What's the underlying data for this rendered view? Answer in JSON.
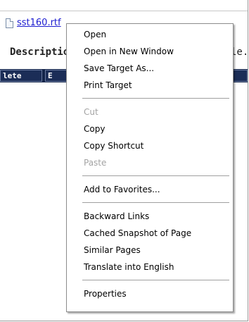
{
  "page": {
    "file_link": "sst160.rtf",
    "description_label": "Description",
    "description_tail": "le.",
    "buttons": {
      "delete": "lete",
      "edit": "E",
      "right": ""
    }
  },
  "context_menu": {
    "groups": [
      [
        {
          "label": "Open",
          "enabled": true
        },
        {
          "label": "Open in New Window",
          "enabled": true
        },
        {
          "label": "Save Target As...",
          "enabled": true
        },
        {
          "label": "Print Target",
          "enabled": true
        }
      ],
      [
        {
          "label": "Cut",
          "enabled": false
        },
        {
          "label": "Copy",
          "enabled": true
        },
        {
          "label": "Copy Shortcut",
          "enabled": true
        },
        {
          "label": "Paste",
          "enabled": false
        }
      ],
      [
        {
          "label": "Add to Favorites...",
          "enabled": true
        }
      ],
      [
        {
          "label": "Backward Links",
          "enabled": true
        },
        {
          "label": "Cached Snapshot of Page",
          "enabled": true
        },
        {
          "label": "Similar Pages",
          "enabled": true
        },
        {
          "label": "Translate into English",
          "enabled": true
        }
      ],
      [
        {
          "label": "Properties",
          "enabled": true
        }
      ]
    ]
  },
  "colors": {
    "link": "#1b1bd0",
    "action_bar": "#14254a",
    "disabled_text": "#a3a3a3"
  }
}
